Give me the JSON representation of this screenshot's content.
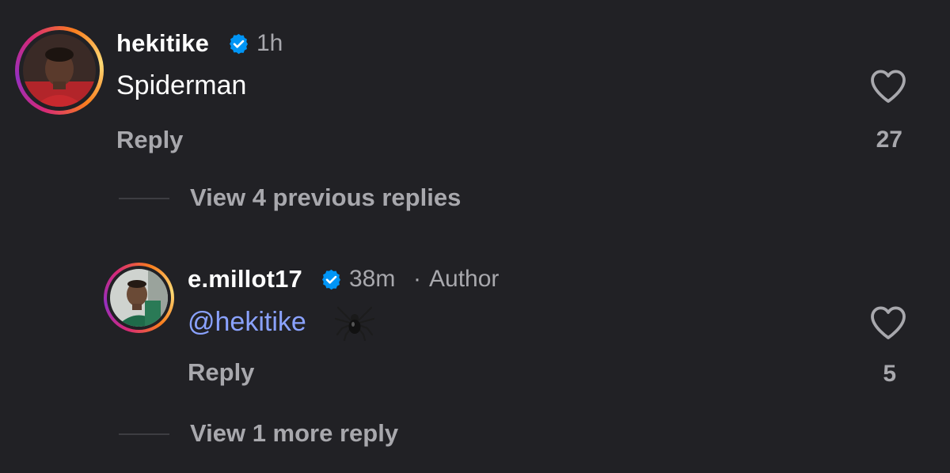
{
  "comment": {
    "username": "hekitike",
    "time": "1h",
    "text": "Spiderman",
    "reply_label": "Reply",
    "likes": "27",
    "view_previous_label": "View 4 previous replies"
  },
  "reply": {
    "username": "e.millot17",
    "time": "38m",
    "separator": "·",
    "author_label": "Author",
    "mention": "@hekitike",
    "emoji": "🕷️",
    "reply_label": "Reply",
    "likes": "5",
    "view_more_label": "View 1 more reply"
  },
  "icons": {
    "verified": "verified-badge-icon",
    "heart": "heart-outline-icon",
    "spider": "spider-emoji-icon"
  },
  "colors": {
    "background": "#212125",
    "verified_blue": "#0095f6",
    "mention_blue": "#8aa2ff",
    "muted_text": "#a8a8ad"
  }
}
